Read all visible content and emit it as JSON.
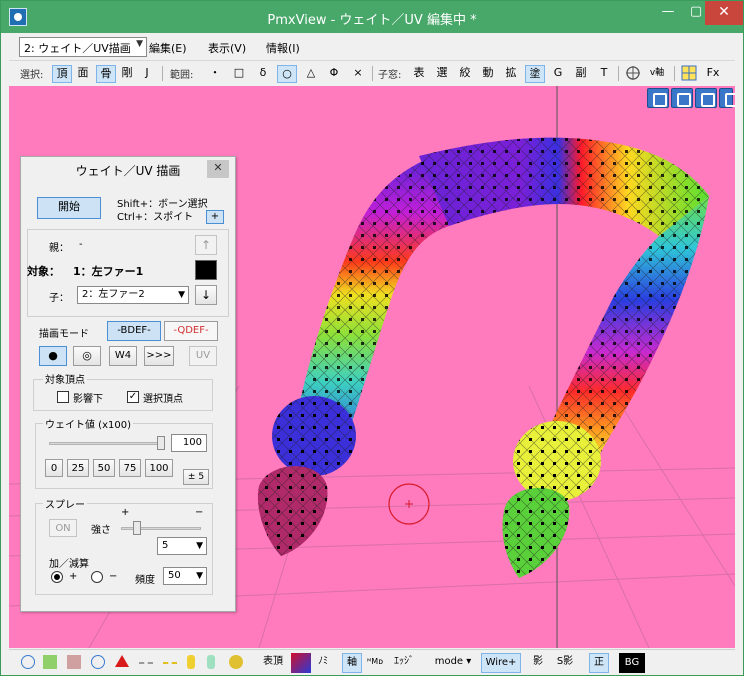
{
  "window": {
    "title": "PmxView  - ウェイト／UV 編集中 *",
    "minimize": "—",
    "maximize": "▢",
    "close": "✕"
  },
  "menubar": {
    "mode_select": "2: ウェイト／UV描画",
    "items": [
      "編集(E)",
      "表示(V)",
      "情報(I)"
    ]
  },
  "toolbar": {
    "select_label": "選択:",
    "select_items": [
      "頂",
      "面",
      "骨",
      "剛",
      "J"
    ],
    "range_label": "範囲:",
    "range_items": [
      "・",
      "□",
      "δ",
      "○",
      "△",
      "Φ",
      "×"
    ],
    "child_label": "子窓:",
    "child_items": [
      "表",
      "選",
      "絞",
      "動",
      "拡",
      "塗",
      "G",
      "副",
      "T"
    ],
    "extra_items": [
      "v軸",
      "Fx"
    ]
  },
  "panel": {
    "title": "ウェイト／UV 描画",
    "close": "✕",
    "start_button": "開始",
    "shift_hint": "Shift+：ボーン選択",
    "ctrl_hint": "Ctrl+：スポイト",
    "plus_button": "+",
    "parent_label": "親：",
    "parent_value": "-",
    "target_label": "対象：",
    "target_value": "1：左ファー1",
    "child_label": "子：",
    "child_value": "2：左ファー2",
    "up_arrow": "↑",
    "down_arrow": "↓",
    "draw_mode_label": "描画モード",
    "bdef_button": "-BDEF-",
    "qdef_button": "-QDEF-",
    "brush_buttons": [
      "●",
      "◎",
      "W4",
      ">>>",
      "UV"
    ],
    "target_vertex_label": "対象頂点",
    "influence_label": "影響下",
    "selected_vertex_label": "選択頂点",
    "weight_label": "ウェイト値 (x100)",
    "weight_value": "100",
    "weight_slider_fraction": 1.0,
    "preset_buttons": [
      "0",
      "25",
      "50",
      "75",
      "100"
    ],
    "pm_button": "± 5",
    "spray_label": "スプレー",
    "spray_plus": "+",
    "spray_minus": "−",
    "spray_on_button": "ON",
    "strength_label": "強さ",
    "strength_value": "5",
    "add_sub_label": "加／減算",
    "add_label": "+",
    "sub_label": "−",
    "freq_label": "頻度",
    "freq_value": "50"
  },
  "statusbar": {
    "items": [
      "表頂",
      "ﾉﾐ",
      "軸",
      "ｴｯｼﾞ",
      "mode ▾",
      "Wire+",
      "影",
      "S影",
      "正",
      "BG"
    ]
  },
  "colors": {
    "viewport_bg": "#ff7bbd",
    "title_bg": "#48a86a",
    "accent": "#4a8fd4"
  }
}
